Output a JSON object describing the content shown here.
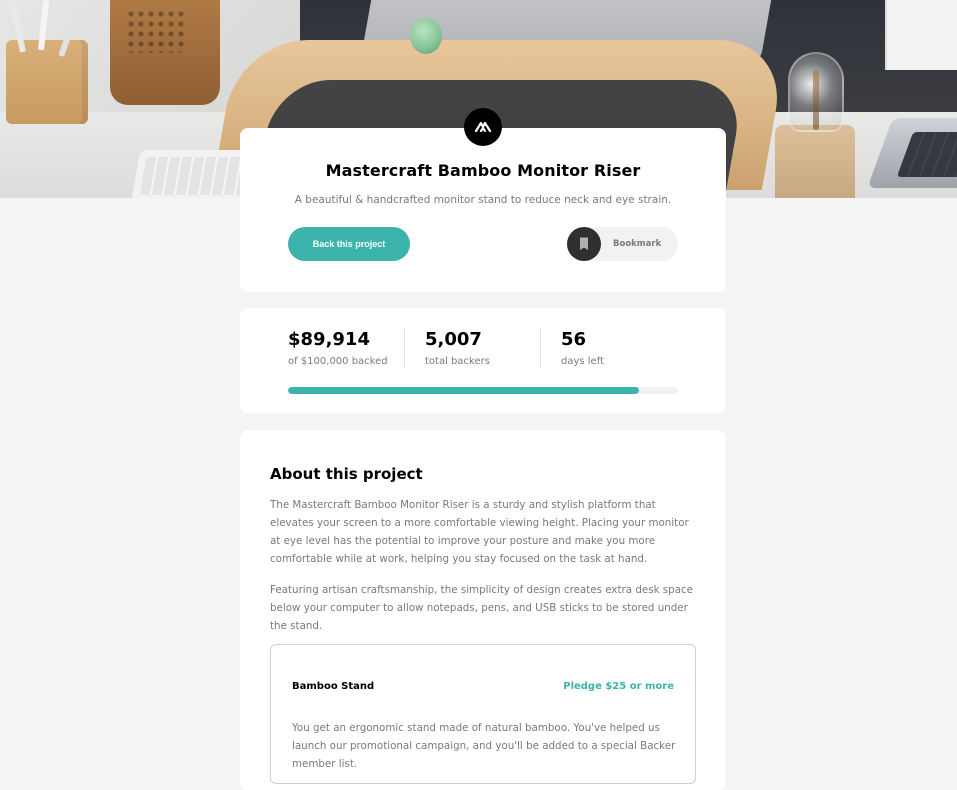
{
  "hero": {
    "alt": "Desk with a bamboo monitor riser, keyboard, and lamp"
  },
  "brand": {
    "logo_icon": "mastercraft-logo-icon",
    "accent": "#3cb3ab"
  },
  "project": {
    "title": "Mastercraft Bamboo Monitor Riser",
    "subtitle": "A beautiful & handcrafted monitor stand to reduce neck and eye strain.",
    "back_label": "Back this project",
    "bookmark_label": "Bookmark",
    "bookmark_icon": "bookmark-icon"
  },
  "stats": {
    "backed_amount": "$89,914",
    "backed_label": "of $100,000 backed",
    "backers_count": "5,007",
    "backers_label": "total backers",
    "days_left": "56",
    "days_label": "days left",
    "progress_fraction": 0.899
  },
  "about": {
    "title": "About this project",
    "p1": "The Mastercraft Bamboo Monitor Riser is a sturdy and stylish platform that elevates your screen to a more comfortable viewing height. Placing your monitor at eye level has the potential to improve your posture and make you more comfortable while at work, helping you stay focused on the task at hand.",
    "p2": "Featuring artisan craftsmanship, the simplicity of design creates extra desk space below your computer to allow notepads, pens, and USB sticks to be stored under the stand."
  },
  "rewards": [
    {
      "title": "Bamboo Stand",
      "pledge": "Pledge $25 or more",
      "desc": "You get an ergonomic stand made of natural bamboo. You've helped us launch our promotional campaign, and you'll be added to a special Backer member list."
    }
  ]
}
